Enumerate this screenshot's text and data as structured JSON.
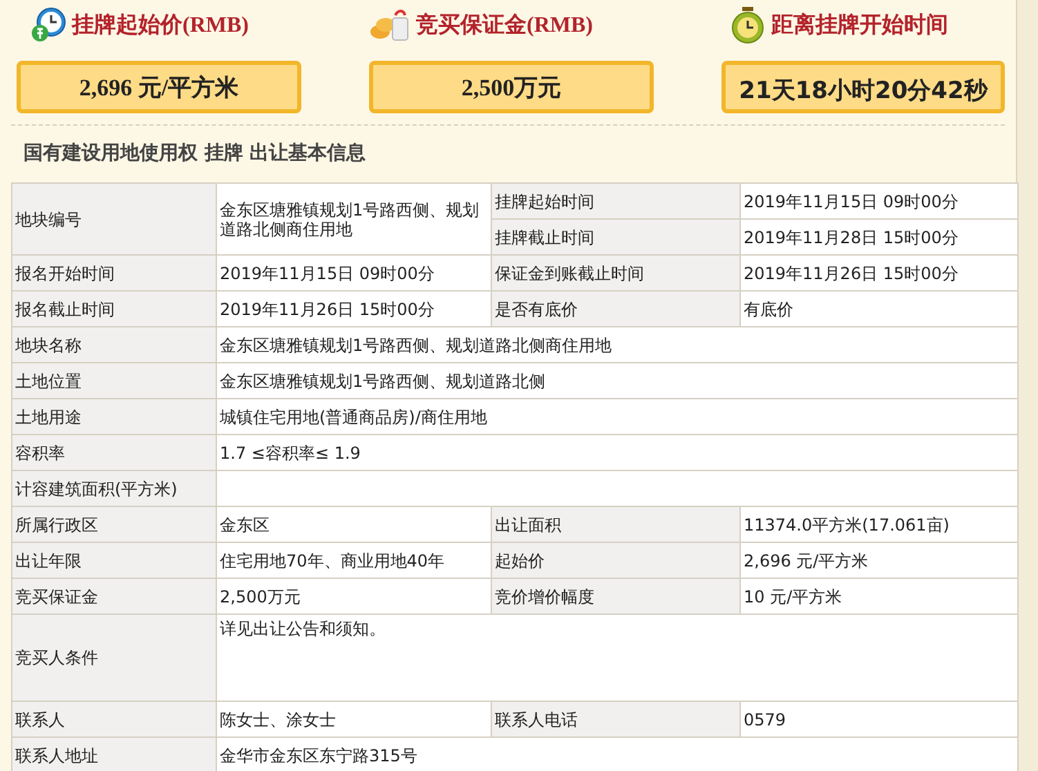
{
  "stats": [
    {
      "kind": "money",
      "title": "挂牌起始价(RMB)",
      "value": "2,696 元/平方米"
    },
    {
      "kind": "coins",
      "title": "竞买保证金(RMB)",
      "value": "2,500万元"
    },
    {
      "kind": "alarm",
      "title": "距离挂牌开始时间",
      "value": "21天18小时20分42秒"
    }
  ],
  "section_title": "国有建设用地使用权 挂牌 出让基本信息",
  "table": {
    "rows": [
      {
        "kind": "split",
        "label": "地块编号",
        "value": "金东区塘雅镇规划1号路西侧、规划道路北侧商住用地",
        "side": [
          {
            "label": "挂牌起始时间",
            "value": "2019年11月15日 09时00分"
          },
          {
            "label": "挂牌截止时间",
            "value": "2019年11月28日 15时00分"
          }
        ]
      },
      {
        "kind": "pair",
        "label": "报名开始时间",
        "value": "2019年11月15日 09时00分",
        "side": [
          {
            "label": "保证金到账截止时间",
            "value": "2019年11月26日 15时00分"
          }
        ]
      },
      {
        "kind": "pair",
        "label": "报名截止时间",
        "value": "2019年11月26日 15时00分",
        "side": [
          {
            "label": "是否有底价",
            "value": "有底价"
          }
        ]
      },
      {
        "kind": "wide",
        "label": "地块名称",
        "value": "金东区塘雅镇规划1号路西侧、规划道路北侧商住用地"
      },
      {
        "kind": "wide",
        "label": "土地位置",
        "value": "金东区塘雅镇规划1号路西侧、规划道路北侧"
      },
      {
        "kind": "wide",
        "label": "土地用途",
        "value": "城镇住宅用地(普通商品房)/商住用地"
      },
      {
        "kind": "wide",
        "label": "容积率",
        "value": "1.7 ≤容积率≤ 1.9"
      },
      {
        "kind": "wide",
        "label": "计容建筑面积(平方米)"
      },
      {
        "kind": "pair",
        "label": "所属行政区",
        "value": "金东区",
        "side": [
          {
            "label": "出让面积",
            "value": "11374.0平方米(17.061亩)"
          }
        ]
      },
      {
        "kind": "pair",
        "label": "出让年限",
        "value": "住宅用地70年、商业用地40年",
        "side": [
          {
            "label": "起始价",
            "value": "2,696 元/平方米"
          }
        ]
      },
      {
        "kind": "pair",
        "label": "竞买保证金",
        "value": "2,500万元",
        "side": [
          {
            "label": "竞价增价幅度",
            "value": "10 元/平方米"
          }
        ]
      },
      {
        "kind": "tall",
        "label": "竞买人条件",
        "value": "详见出让公告和须知。"
      },
      {
        "kind": "pair",
        "label": "联系人",
        "value": "陈女士、涂女士",
        "side": [
          {
            "label": "联系人电话",
            "value": "0579"
          }
        ]
      },
      {
        "kind": "wide",
        "label": "联系人地址",
        "value": "金华市金东区东宁路315号"
      }
    ]
  }
}
